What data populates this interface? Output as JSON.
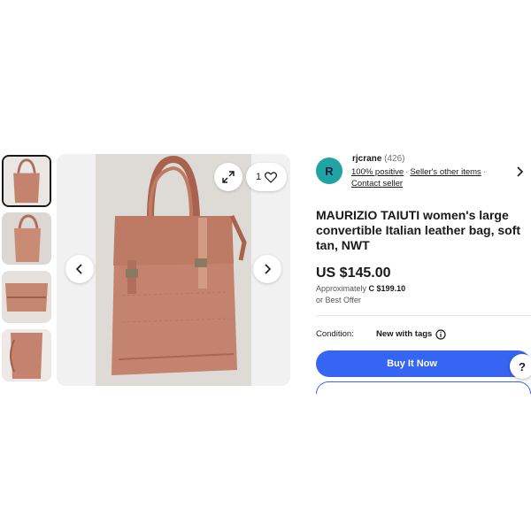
{
  "gallery": {
    "watch_count": "1",
    "thumbnails": [
      "thumb-1",
      "thumb-2",
      "thumb-3",
      "thumb-4"
    ],
    "icons": [
      "expand-icon",
      "heart-icon",
      "chevron-left-icon",
      "chevron-right-icon"
    ]
  },
  "seller": {
    "avatar_initial": "R",
    "name": "rjcrane",
    "feedback_count": "(426)",
    "positive": "100% positive",
    "other_items": "Seller's other items",
    "contact": "Contact seller"
  },
  "listing": {
    "title": "MAURIZIO TAIUTI women's large convertible Italian leather bag, soft tan, NWT",
    "price": "US $145.00",
    "approx_prefix": "Approximately",
    "approx_value": "C $199.10",
    "best_offer": "or Best Offer",
    "condition_label": "Condition:",
    "condition_value": "New with tags"
  },
  "actions": {
    "buy_now": "Buy It Now",
    "help": "?"
  },
  "colors": {
    "accent": "#3665f3",
    "avatar": "#1fa3a4",
    "bag": "#c4836e"
  }
}
